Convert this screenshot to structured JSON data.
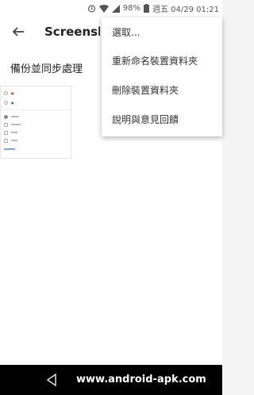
{
  "status": {
    "battery": "98%",
    "datetime": "週五 04/29 01:21"
  },
  "appbar": {
    "title": "Screenshots"
  },
  "content": {
    "section_title": "備份並同步處理",
    "thumbnail_rows": [
      "",
      "",
      "",
      "",
      "",
      "",
      "",
      ""
    ]
  },
  "menu": {
    "items": [
      {
        "label": "選取..."
      },
      {
        "label": "重新命名裝置資料夾"
      },
      {
        "label": "刪除裝置資料夾"
      },
      {
        "label": "說明與意見回饋"
      }
    ]
  },
  "watermark": "www.android-apk.com"
}
